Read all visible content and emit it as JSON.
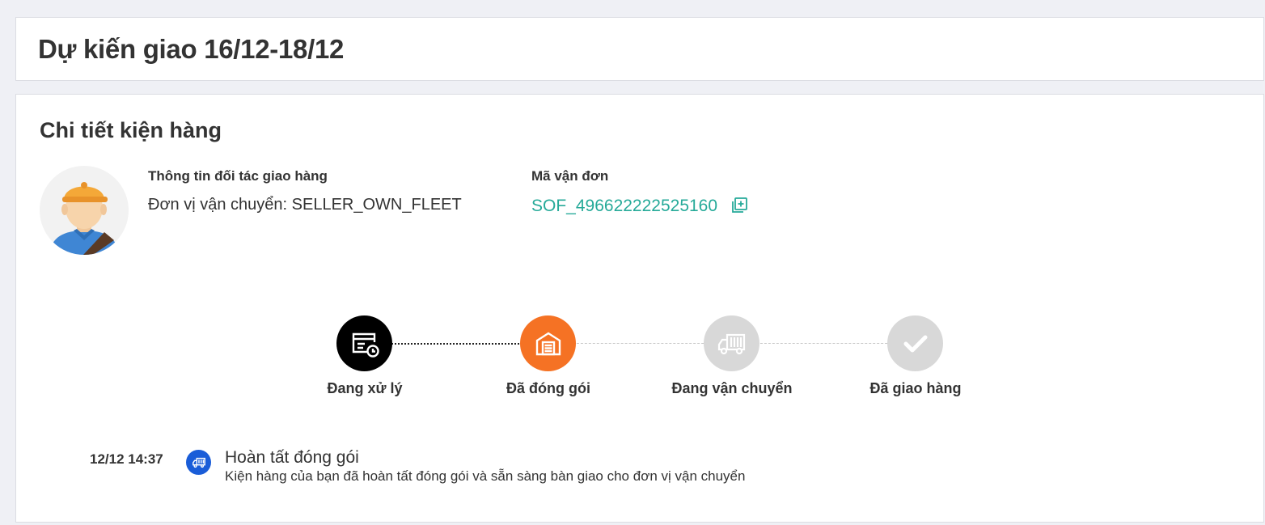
{
  "header": {
    "title": "Dự kiến giao 16/12-18/12"
  },
  "package_detail": {
    "title": "Chi tiết kiện hàng",
    "avatar_icon": "delivery-man-avatar",
    "partner_heading": "Thông tin đối tác giao hàng",
    "carrier_line": "Đơn vị vận chuyển: SELLER_OWN_FLEET",
    "tracking_heading": "Mã vận đơn",
    "tracking_number": "SOF_496622222525160",
    "copy_icon": "copy-icon",
    "accent_color": "#26aa99"
  },
  "progress": {
    "steps": [
      {
        "label": "Đang xử lý",
        "icon": "processing-clock-icon",
        "state": "done",
        "color": "#000000"
      },
      {
        "label": "Đã đóng gói",
        "icon": "warehouse-package-icon",
        "state": "current",
        "color": "#f57224"
      },
      {
        "label": "Đang vận chuyển",
        "icon": "truck-icon",
        "state": "pending",
        "color": "#d8d8d8"
      },
      {
        "label": "Đã giao hàng",
        "icon": "checkmark-icon",
        "state": "pending",
        "color": "#d8d8d8"
      }
    ]
  },
  "timeline": {
    "events": [
      {
        "time": "12/12 14:37",
        "icon": "truck-icon",
        "title": "Hoàn tất đóng gói",
        "description": "Kiện hàng của bạn đã hoàn tất đóng gói và sẵn sàng bàn giao cho đơn vị vận chuyển",
        "color": "#1a5dd8"
      }
    ]
  }
}
